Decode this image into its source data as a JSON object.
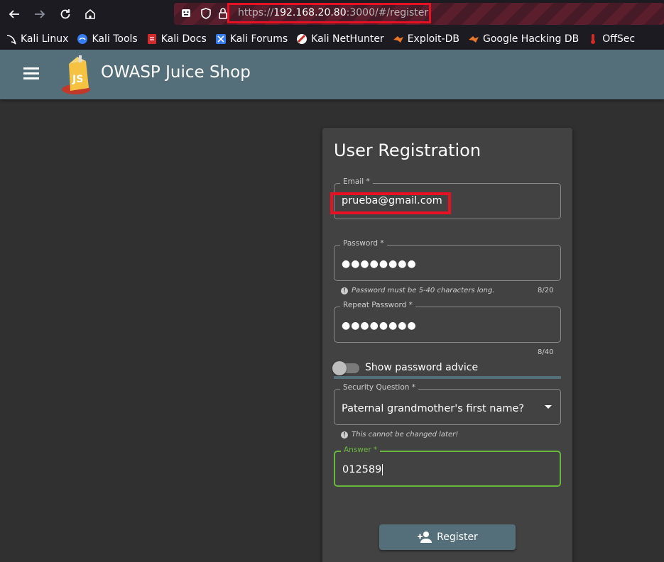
{
  "browser": {
    "url_prefix": "https://",
    "url_host": "192.168.20.80",
    "url_suffix": ":3000/#/register",
    "bookmarks": [
      {
        "label": "Kali Linux",
        "icon": "kali-dragon-icon"
      },
      {
        "label": "Kali Tools",
        "icon": "kali-tools-icon"
      },
      {
        "label": "Kali Docs",
        "icon": "kali-docs-icon"
      },
      {
        "label": "Kali Forums",
        "icon": "kali-forums-icon"
      },
      {
        "label": "Kali NetHunter",
        "icon": "nethunter-icon"
      },
      {
        "label": "Exploit-DB",
        "icon": "exploit-db-icon"
      },
      {
        "label": "Google Hacking DB",
        "icon": "ghdb-icon"
      },
      {
        "label": "OffSec",
        "icon": "offsec-icon"
      }
    ]
  },
  "header": {
    "title": "OWASP Juice Shop"
  },
  "form": {
    "title": "User Registration",
    "email": {
      "label": "Email *",
      "value": "prueba@gmail.com"
    },
    "password": {
      "label": "Password *",
      "value": "●●●●●●●●",
      "hint": "Password must be 5-40 characters long.",
      "counter": "8/20"
    },
    "repeat_password": {
      "label": "Repeat Password *",
      "value": "●●●●●●●●",
      "counter": "8/40"
    },
    "password_advice": {
      "label": "Show password advice",
      "checked": false
    },
    "security_question": {
      "label": "Security Question *",
      "value": "Paternal grandmother's first name?",
      "hint": "This cannot be changed later!"
    },
    "answer": {
      "label": "Answer *",
      "value": "012589"
    },
    "register_label": "Register"
  },
  "colors": {
    "header_bg": "#546e7a",
    "page_bg": "#303030",
    "card_bg": "#424242",
    "focus_green": "#69b73c",
    "highlight_red": "#e81123"
  }
}
